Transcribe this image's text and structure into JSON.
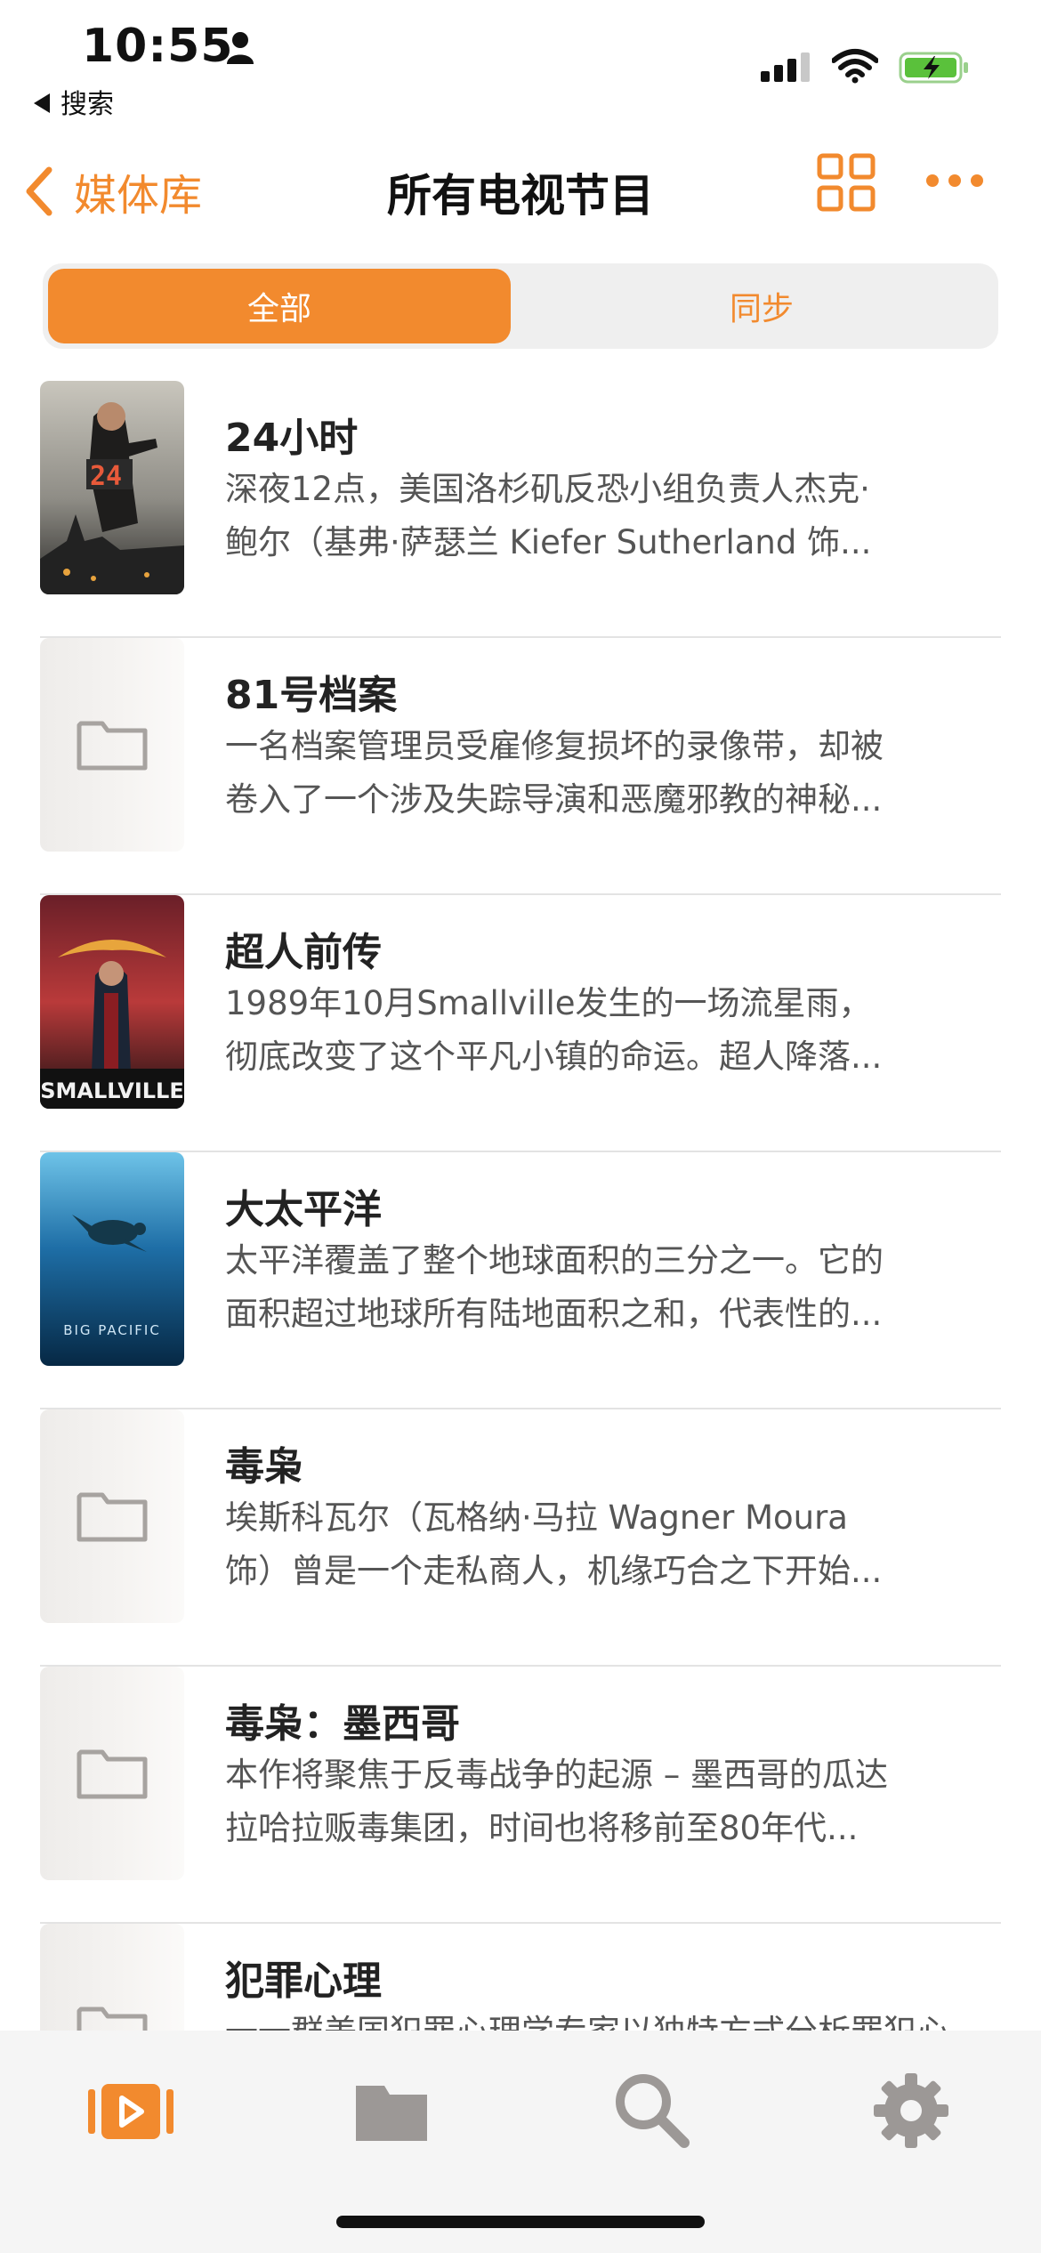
{
  "status_bar": {
    "time": "10:55",
    "back_label": "搜索"
  },
  "nav": {
    "back_label": "媒体库",
    "title": "所有电视节目"
  },
  "segment": {
    "all_label": "全部",
    "sync_label": "同步"
  },
  "colors": {
    "accent": "#f28a2e",
    "tab_inactive": "#9c9896"
  },
  "items": [
    {
      "title": "24小时",
      "desc_line1": "深夜12点，美国洛杉矶反恐小组负责人杰克·",
      "desc_line2": "鲍尔（基弗·萨瑟兰 Kiefer Sutherland 饰...",
      "poster": "24"
    },
    {
      "title": "81号档案",
      "desc_line1": "一名档案管理员受雇修复损坏的录像带，却被",
      "desc_line2": "卷入了一个涉及失踪导演和恶魔邪教的神秘...",
      "poster": "folder"
    },
    {
      "title": "超人前传",
      "desc_line1": "1989年10月Smallville发生的一场流星雨，",
      "desc_line2": "彻底改变了这个平凡小镇的命运。超人降落...",
      "poster": "smallville",
      "poster_text": "SMALLVILLE"
    },
    {
      "title": "大太平洋",
      "desc_line1": "太平洋覆盖了整个地球面积的三分之一。它的",
      "desc_line2": "面积超过地球所有陆地面积之和，代表性的...",
      "poster": "bigpacific",
      "poster_text": "BIG PACIFIC"
    },
    {
      "title": "毒枭",
      "desc_line1": "埃斯科瓦尔（瓦格纳·马拉 Wagner Moura",
      "desc_line2": "饰）曾是一个走私商人，机缘巧合之下开始...",
      "poster": "folder"
    },
    {
      "title": "毒枭：墨西哥",
      "desc_line1": "本作将聚焦于反毒战争的起源 – 墨西哥的瓜达",
      "desc_line2": "拉哈拉贩毒集团，时间也将移前至80年代...",
      "poster": "folder"
    },
    {
      "title": "犯罪心理",
      "desc_line1": "一一群美国犯罪心理学专家以独特方式分析罪犯心",
      "desc_line2": "",
      "poster": "folder"
    }
  ],
  "tabs": [
    {
      "name": "library",
      "icon": "play-library-icon",
      "active": true
    },
    {
      "name": "folders",
      "icon": "folder-icon",
      "active": false
    },
    {
      "name": "search",
      "icon": "search-icon",
      "active": false
    },
    {
      "name": "settings",
      "icon": "gear-icon",
      "active": false
    }
  ]
}
